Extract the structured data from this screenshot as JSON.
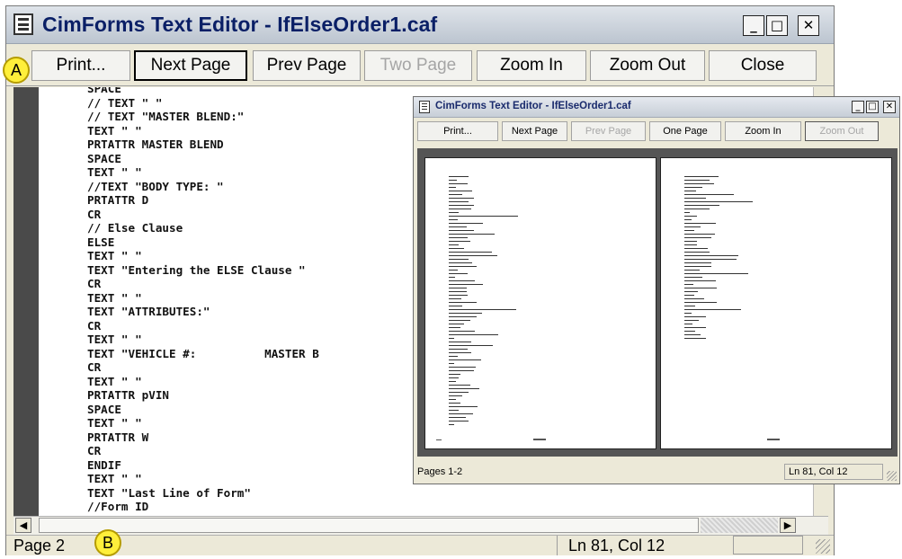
{
  "main_window": {
    "title": "CimForms Text Editor - IfElseOrder1.caf",
    "caption_buttons": {
      "minimize": "_",
      "maximize": "□",
      "close": "✕"
    },
    "toolbar": {
      "print": "Print...",
      "next_page": "Next Page",
      "prev_page": "Prev Page",
      "two_page": "Two Page",
      "zoom_in": "Zoom In",
      "zoom_out": "Zoom Out",
      "close": "Close"
    },
    "code_lines": [
      "SPACE",
      "// TEXT \" \"",
      "// TEXT \"MASTER BLEND:\"",
      "TEXT \" \"",
      "PRTATTR MASTER BLEND",
      "SPACE",
      "TEXT \" \"",
      "//TEXT \"BODY TYPE: \"",
      "PRTATTR D",
      "CR",
      "// Else Clause",
      "ELSE",
      "TEXT \" \"",
      "TEXT \"Entering the ELSE Clause \"",
      "CR",
      "TEXT \" \"",
      "TEXT \"ATTRIBUTES:\"",
      "CR",
      "TEXT \" \"",
      "TEXT \"VEHICLE #:          MASTER B",
      "CR",
      "TEXT \" \"",
      "PRTATTR pVIN",
      "SPACE",
      "TEXT \" \"",
      "PRTATTR W",
      "CR",
      "ENDIF",
      "TEXT \" \"",
      "TEXT \"Last Line of Form\"",
      "//Form ID"
    ],
    "status": {
      "page": "Page 2",
      "position": "Ln 81, Col 12"
    },
    "callouts": {
      "a": "A",
      "b": "B"
    },
    "scroll_arrows": {
      "left": "◀",
      "right": "▶"
    }
  },
  "preview_window": {
    "title": "CimForms Text Editor - IfElseOrder1.caf",
    "toolbar": {
      "print": "Print...",
      "next_page": "Next Page",
      "prev_page": "Prev Page",
      "one_page": "One Page",
      "zoom_in": "Zoom In",
      "zoom_out": "Zoom Out"
    },
    "status": {
      "pages": "Pages 1-2",
      "position": "Ln 81, Col 12"
    }
  },
  "colors": {
    "callout_fill": "#ffef3b",
    "title_text": "#0a1f66",
    "gutter": "#4a4a4a"
  }
}
